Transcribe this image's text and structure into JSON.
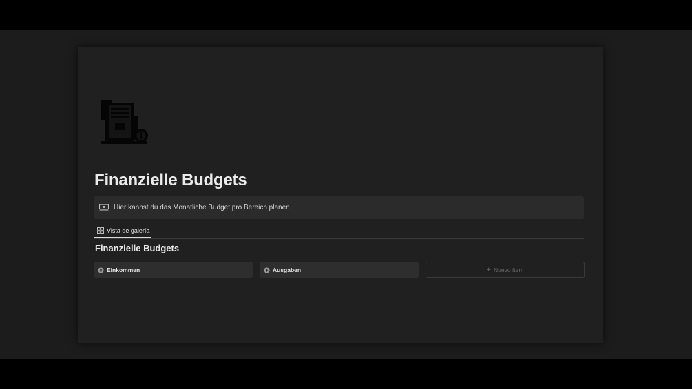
{
  "page": {
    "icon": "budget-document-icon",
    "title": "Finanzielle Budgets"
  },
  "callout": {
    "icon": "money-icon",
    "text": "Hier kannst du das Monatliche Budget pro Bereich planen."
  },
  "views": [
    {
      "icon": "gallery-grid-icon",
      "label": "Vista de galería",
      "active": true
    }
  ],
  "database": {
    "title": "Finanzielle Budgets",
    "cards": [
      {
        "icon": "arrow-up-circle-icon",
        "label": "Einkommen"
      },
      {
        "icon": "arrow-down-circle-icon",
        "label": "Ausgaben"
      }
    ],
    "new_item_label": "Nuevo ítem"
  },
  "colors": {
    "background": "#1c1c1c",
    "page": "#202020",
    "text": "#ebebeb",
    "card": "#2e2e2e"
  }
}
